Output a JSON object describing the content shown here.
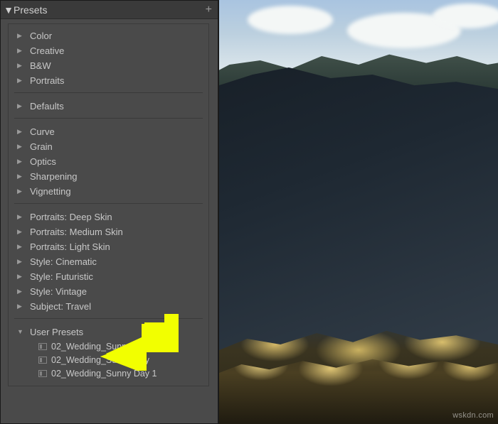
{
  "header": {
    "title": "Presets",
    "add_tooltip": "+"
  },
  "groups": {
    "a": [
      {
        "label": "Color"
      },
      {
        "label": "Creative"
      },
      {
        "label": "B&W"
      },
      {
        "label": "Portraits"
      }
    ],
    "b": [
      {
        "label": "Defaults"
      }
    ],
    "c": [
      {
        "label": "Curve"
      },
      {
        "label": "Grain"
      },
      {
        "label": "Optics"
      },
      {
        "label": "Sharpening"
      },
      {
        "label": "Vignetting"
      }
    ],
    "d": [
      {
        "label": "Portraits: Deep Skin"
      },
      {
        "label": "Portraits: Medium Skin"
      },
      {
        "label": "Portraits: Light Skin"
      },
      {
        "label": "Style: Cinematic"
      },
      {
        "label": "Style: Futuristic"
      },
      {
        "label": "Style: Vintage"
      },
      {
        "label": "Subject: Travel"
      }
    ],
    "user": {
      "label": "User Presets",
      "items": [
        {
          "label": "02_Wedding_Sunny Day"
        },
        {
          "label": "02_Wedding_Sunny Day"
        },
        {
          "label": "02_Wedding_Sunny Day 1"
        }
      ]
    }
  },
  "watermark": "wskdn.com",
  "colors": {
    "arrow": "#f2ff00"
  }
}
